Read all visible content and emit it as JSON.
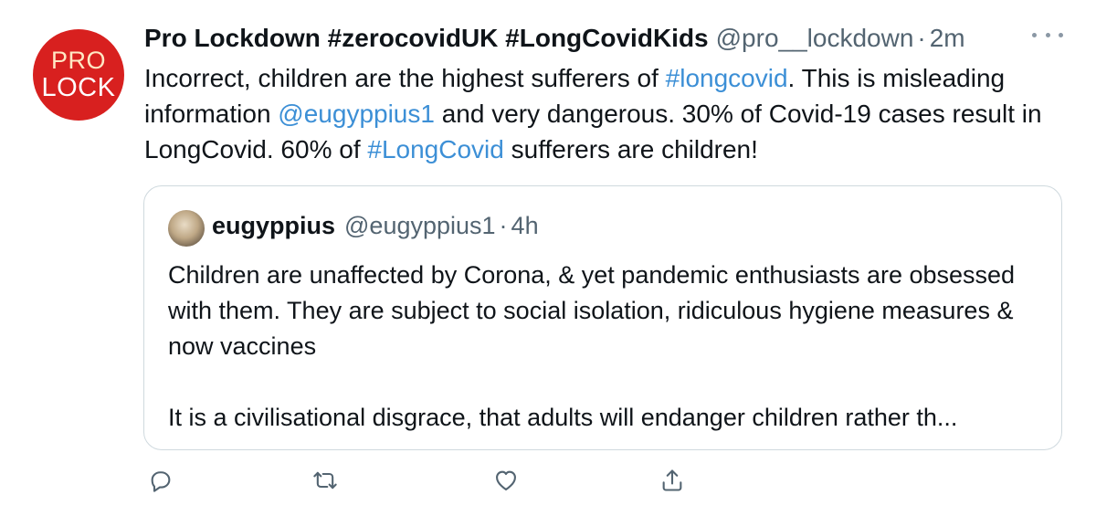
{
  "tweet": {
    "avatar": {
      "line1": "PRO",
      "line2": "LOCK",
      "color": "#d8201f"
    },
    "display_name": "Pro Lockdown #zerocovidUK #LongCovidKids",
    "handle": "@pro__lockdown",
    "separator": "·",
    "time": "2m",
    "body": {
      "p1": "Incorrect, children are the highest sufferers of ",
      "tag1": "#longcovid",
      "p2": ". This is misleading information ",
      "mention": "@eugyppius1",
      "p3": " and very dangerous. 30% of Covid-19 cases result in LongCovid. 60% of ",
      "tag2": "#LongCovid",
      "p4": " sufferers are children!"
    },
    "link_color": "#3c8fd6"
  },
  "quote": {
    "display_name": "eugyppius",
    "handle": "@eugyppius1",
    "separator": "·",
    "time": "4h",
    "paragraph1": "Children are unaffected by Corona, & yet pandemic enthusiasts are obsessed with them. They are subject to social isolation, ridiculous hygiene measures & now vaccines",
    "paragraph2": "It is a civilisational disgrace, that adults will endanger children rather th..."
  },
  "actions": {
    "reply_icon": "reply-icon",
    "retweet_icon": "retweet-icon",
    "like_icon": "heart-icon",
    "share_icon": "share-icon",
    "icon_color": "#536471"
  }
}
